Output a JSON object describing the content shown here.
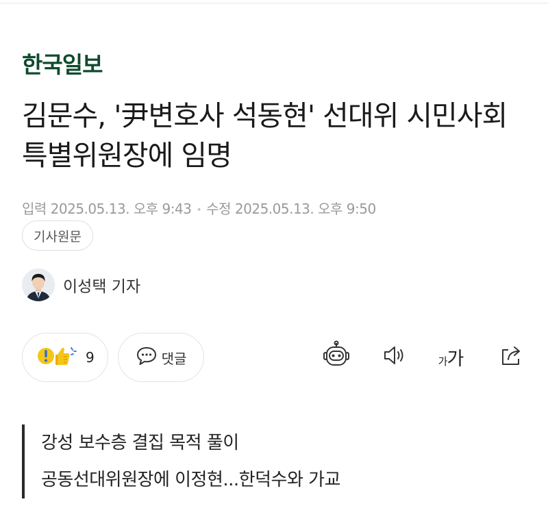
{
  "publisher": "한국일보",
  "headline": "김문수, '尹변호사 석동현' 선대위 시민사회특별위원장에 임명",
  "dates": {
    "published": "입력 2025.05.13. 오후 9:43",
    "updated": "수정 2025.05.13. 오후 9:50"
  },
  "original_article_label": "기사원문",
  "reporter": {
    "name": "이성택 기자"
  },
  "actions": {
    "reaction_count": "9",
    "comment_label": "댓글",
    "font_size_label_small": "가",
    "font_size_label_large": "가"
  },
  "icons": [
    "reaction-icon",
    "comment-icon",
    "ai-summary-bot-icon",
    "audio-speaker-icon",
    "font-size-icon",
    "share-icon"
  ],
  "summary": [
    "강성 보수층 결집 목적 풀이",
    "공동선대위원장에 이정현...한덕수와 가교"
  ],
  "colors": {
    "publisher_green": "#0f4a2e",
    "reaction_yellow": "#f5c518",
    "reaction_blue": "#2f6bdc"
  }
}
